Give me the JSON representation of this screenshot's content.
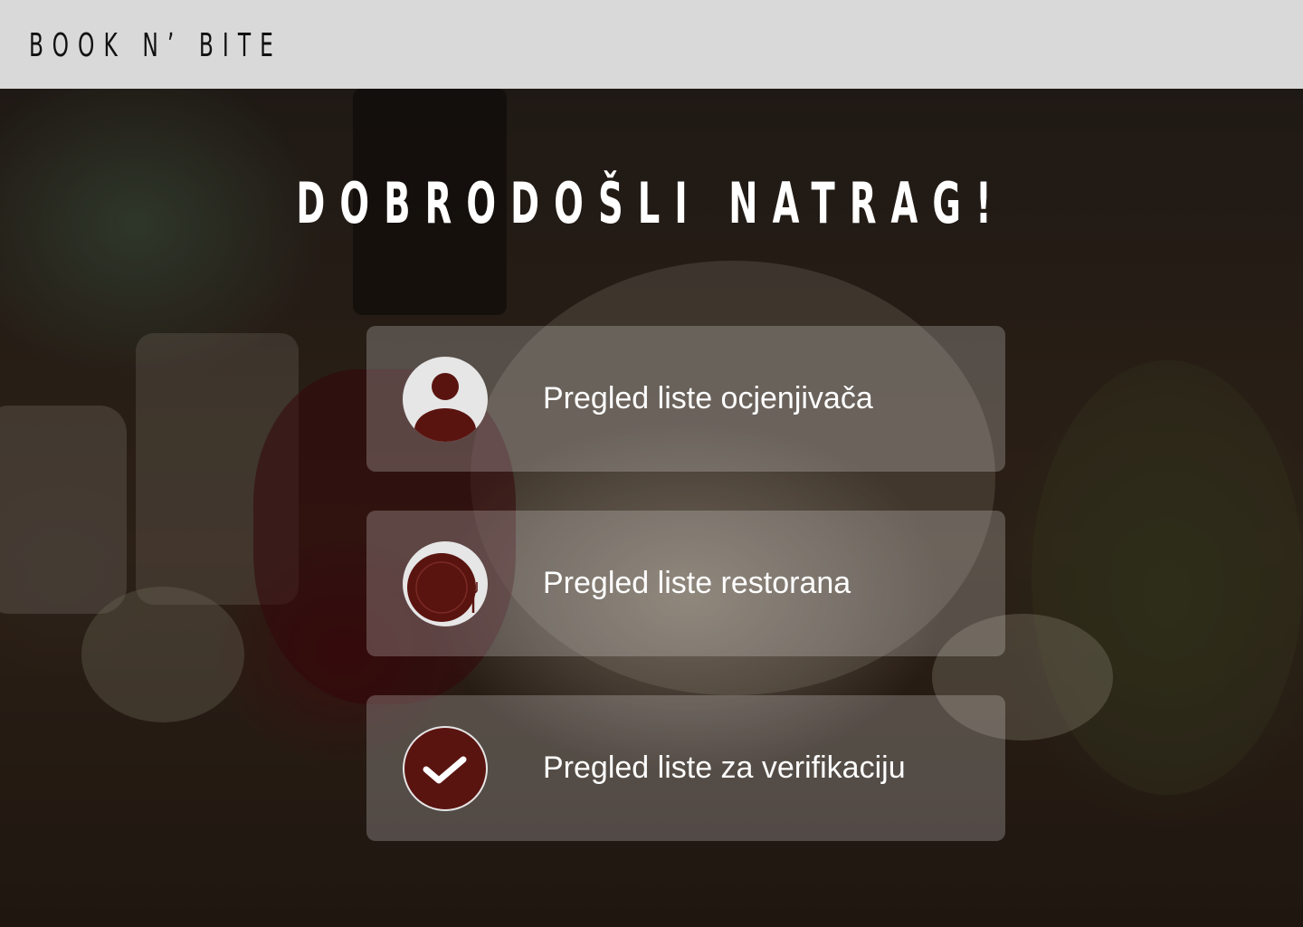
{
  "brand": {
    "logo_text": "BOOK N’ BITE"
  },
  "hero": {
    "headline": "DOBRODOŠLI NATRAG!"
  },
  "menu": {
    "items": [
      {
        "label": "Pregled liste ocjenjivača",
        "icon": "user-avatar-icon"
      },
      {
        "label": "Pregled liste restorana",
        "icon": "plate-fork-icon"
      },
      {
        "label": "Pregled liste za verifikaciju",
        "icon": "checkmark-circle-icon"
      }
    ]
  },
  "colors": {
    "topbar_bg": "#d9d9d9",
    "icon_accent": "#5a1410",
    "icon_bg": "#e6e6e6",
    "text_light": "#ffffff"
  }
}
